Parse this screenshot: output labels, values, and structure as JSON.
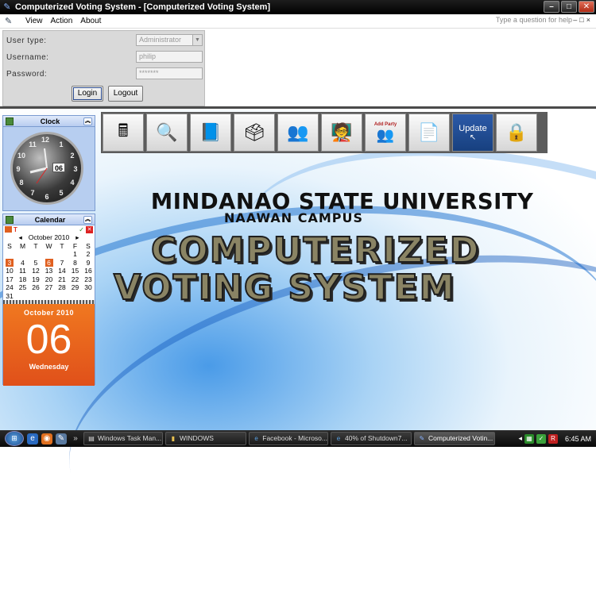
{
  "window": {
    "title": "Computerized Voting System - [Computerized Voting System]",
    "help_placeholder": "Type a question for help"
  },
  "menu": [
    "View",
    "Action",
    "About"
  ],
  "login": {
    "user_type_label": "User type:",
    "user_type_value": "Administrator",
    "username_label": "Username:",
    "username_value": "philip",
    "password_label": "Password:",
    "password_value": "*******",
    "login_button": "Login",
    "logout_button": "Logout"
  },
  "clock": {
    "title": "Clock",
    "date_box": "06",
    "numbers": [
      "12",
      "1",
      "2",
      "3",
      "4",
      "5",
      "6",
      "7",
      "8",
      "9",
      "10",
      "11"
    ]
  },
  "calendar": {
    "title": "Calendar",
    "month_label": "October 2010",
    "weekdays": [
      "S",
      "M",
      "T",
      "W",
      "T",
      "F",
      "S"
    ],
    "weeks": [
      [
        "",
        "",
        "",
        "",
        "",
        "1",
        "2"
      ],
      [
        "3",
        "4",
        "5",
        "6",
        "7",
        "8",
        "9"
      ],
      [
        "10",
        "11",
        "12",
        "13",
        "14",
        "15",
        "16"
      ],
      [
        "17",
        "18",
        "19",
        "20",
        "21",
        "22",
        "23"
      ],
      [
        "24",
        "25",
        "26",
        "27",
        "28",
        "29",
        "30"
      ],
      [
        "31",
        "",
        "",
        "",
        "",
        "",
        ""
      ]
    ],
    "highlighted": [
      "3",
      "6"
    ],
    "big_month": "October 2010",
    "big_day": "06",
    "big_weekday": "Wednesday"
  },
  "toolbar": {
    "update_label": "Update",
    "add_party_label": "Add Party"
  },
  "banner": {
    "university": "MINDANAO STATE UNIVERSITY",
    "campus": "NAAWAN CAMPUS",
    "line1": "COMPUTERIZED",
    "line2": "VOTING SYSTEM"
  },
  "taskbar": {
    "tasks": [
      "Windows Task Man...",
      "WINDOWS",
      "Facebook - Microso...",
      "40% of Shutdown7...",
      "Computerized Votin..."
    ],
    "time": "6:45 AM"
  },
  "colors": {
    "accent_orange": "#e0501a",
    "update_blue": "#1d4b92",
    "title_bar": "#000000"
  }
}
